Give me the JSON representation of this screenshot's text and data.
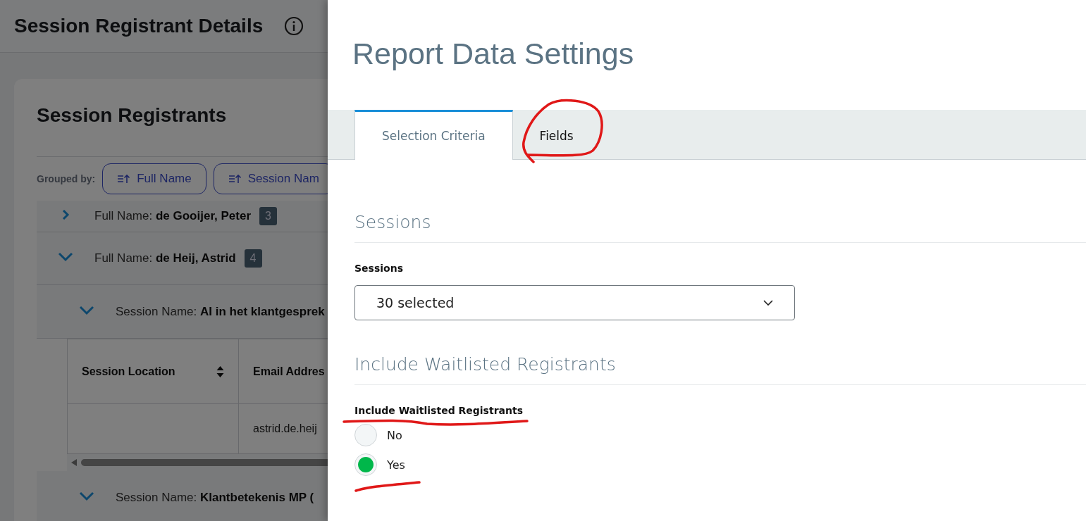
{
  "page": {
    "title": "Session Registrant Details"
  },
  "registrants": {
    "title": "Session Registrants",
    "grouped_by_label": "Grouped by:",
    "group_buttons": [
      {
        "label": "Full Name"
      },
      {
        "label": "Session Nam"
      }
    ],
    "rows": [
      {
        "label": "Full Name:",
        "value": "de Gooijer, Peter",
        "count": "3",
        "expanded": false
      },
      {
        "label": "Full Name:",
        "value": "de Heij, Astrid",
        "count": "4",
        "expanded": true,
        "children": [
          {
            "label": "Session Name:",
            "value": "AI in het klantgesprek",
            "expanded": true,
            "table": {
              "columns": [
                {
                  "label": "Session Location",
                  "sortable": true
                },
                {
                  "label": "Email Addres",
                  "sortable": false
                }
              ],
              "rows": [
                {
                  "email_address": "astrid.de.heij"
                }
              ]
            }
          },
          {
            "label": "Session Name:",
            "value": "Klantbetekenis MP (",
            "expanded": true
          }
        ]
      }
    ]
  },
  "settings": {
    "title": "Report Data Settings",
    "tabs": [
      {
        "label": "Selection Criteria",
        "selected": true
      },
      {
        "label": "Fields",
        "selected": false
      }
    ],
    "sections": [
      {
        "heading": "Sessions",
        "kind": "dropdown",
        "label": "Sessions",
        "value": "30 selected"
      },
      {
        "heading": "Include Waitlisted Registrants",
        "kind": "radio",
        "label": "Include Waitlisted Registrants",
        "options": [
          {
            "label": "No",
            "selected": false
          },
          {
            "label": "Yes",
            "selected": true
          }
        ]
      }
    ]
  }
}
